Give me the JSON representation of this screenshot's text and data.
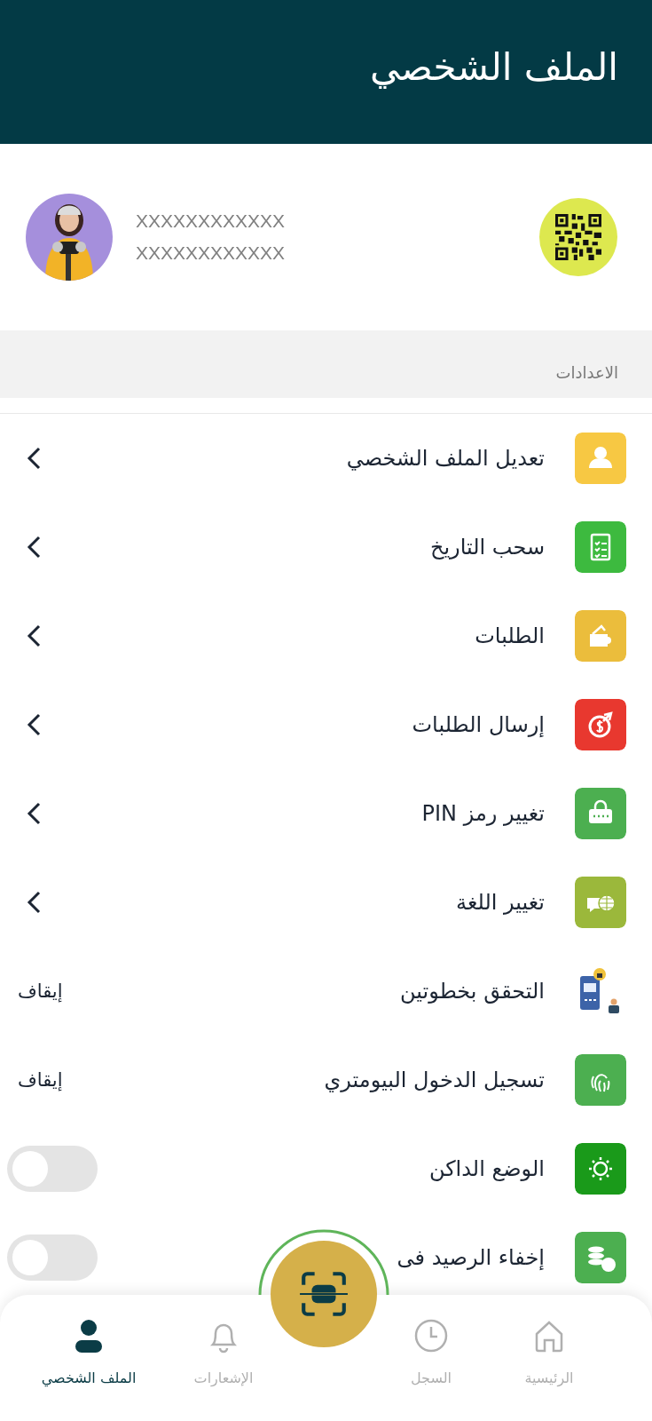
{
  "header": {
    "title": "الملف الشخصي"
  },
  "profile": {
    "lines": [
      "XXXXXXXXXXXX",
      "XXXXXXXXXXXX"
    ]
  },
  "section": {
    "title": "الاعدادات"
  },
  "settings": [
    {
      "label": "تعديل الملف الشخصي",
      "kind": "link",
      "color": "#f7c843"
    },
    {
      "label": "سحب التاريخ",
      "kind": "link",
      "color": "#3dba3f"
    },
    {
      "label": "الطلبات",
      "kind": "link",
      "color": "#ebbd3c"
    },
    {
      "label": "إرسال الطلبات",
      "kind": "link",
      "color": "#e8382f"
    },
    {
      "label": "تغيير رمز PIN",
      "kind": "link",
      "color": "#4caf50"
    },
    {
      "label": "تغيير اللغة",
      "kind": "link",
      "color": "#9bb83b"
    },
    {
      "label": "التحقق بخطوتين",
      "kind": "status",
      "status": "إيقاف"
    },
    {
      "label": "تسجيل الدخول البيومتري",
      "kind": "status",
      "status": "إيقاف",
      "color": "#4caf50"
    },
    {
      "label": "الوضع الداكن",
      "kind": "toggle",
      "on": false,
      "color": "#1a9a1a"
    },
    {
      "label": "إخفاء الرصيد فى",
      "kind": "toggle",
      "on": false,
      "color": "#4caf50"
    }
  ],
  "nav": [
    {
      "label": "الرئيسية",
      "selected": false
    },
    {
      "label": "السجل",
      "selected": false
    },
    {
      "label": "الإشعارات",
      "selected": false
    },
    {
      "label": "الملف الشخصي",
      "selected": true
    }
  ]
}
